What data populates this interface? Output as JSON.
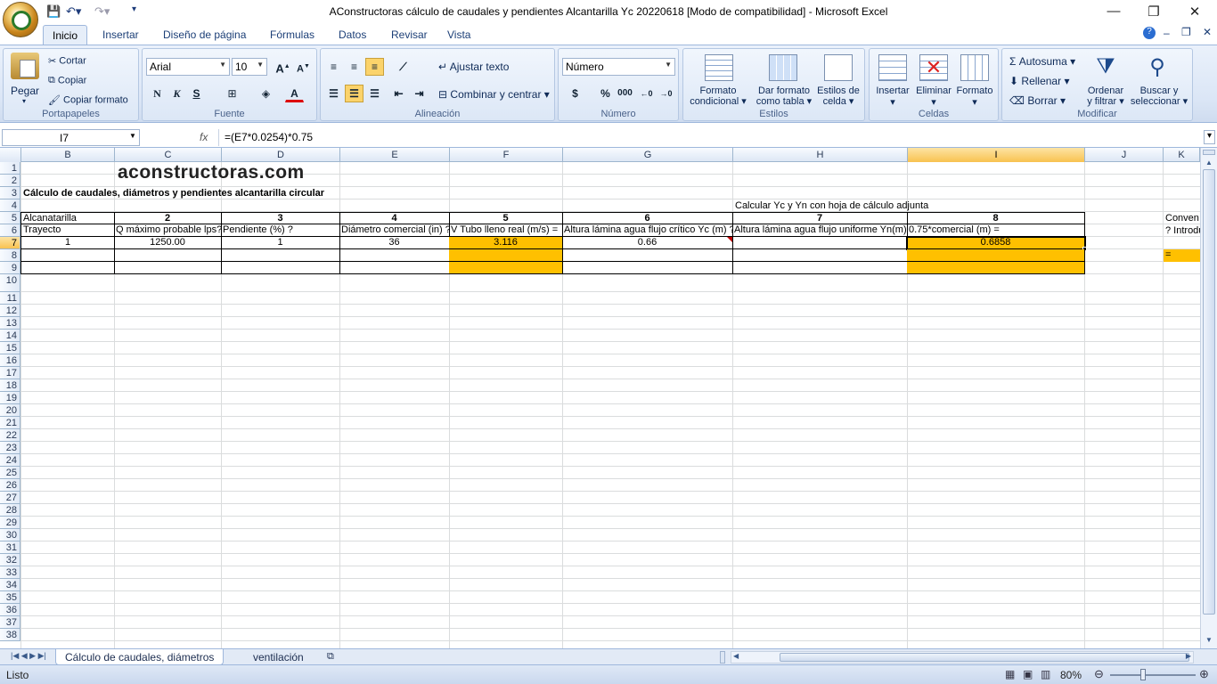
{
  "window": {
    "title": "AConstructoras cálculo de caudales y pendientes Alcantarilla Yc 20220618  [Modo de compatibilidad] - Microsoft Excel",
    "min": "—",
    "restore": "❐",
    "close": "✕"
  },
  "tabs": [
    "Inicio",
    "Insertar",
    "Diseño de página",
    "Fórmulas",
    "Datos",
    "Revisar",
    "Vista"
  ],
  "ribbon": {
    "portapapeles": {
      "label": "Portapapeles",
      "pegar": "Pegar",
      "cortar": "Cortar",
      "copiar": "Copiar",
      "copiar_formato": "Copiar formato"
    },
    "fuente": {
      "label": "Fuente",
      "font": "Arial",
      "size": "10",
      "bold": "N",
      "italic": "K",
      "underline": "S"
    },
    "alineacion": {
      "label": "Alineación",
      "ajustar": "Ajustar texto",
      "combinar": "Combinar y centrar"
    },
    "numero": {
      "label": "Número",
      "format": "Número",
      "currency": "$",
      "percent": "%",
      "thousands": "000"
    },
    "estilos": {
      "label": "Estilos",
      "formato_cond": [
        "Formato",
        "condicional"
      ],
      "dar_formato": [
        "Dar formato",
        "como tabla"
      ],
      "estilos_celda": [
        "Estilos de",
        "celda"
      ]
    },
    "celdas": {
      "label": "Celdas",
      "insertar": "Insertar",
      "eliminar": "Eliminar",
      "formato": "Formato"
    },
    "modificar": {
      "label": "Modificar",
      "autosuma": "Autosuma",
      "rellenar": "Rellenar",
      "borrar": "Borrar",
      "ordenar": [
        "Ordenar",
        "y filtrar"
      ],
      "buscar": [
        "Buscar y",
        "seleccionar"
      ]
    }
  },
  "formula_bar": {
    "name_box": "I7",
    "fx": "fx",
    "formula": "=(E7*0.0254)*0.75"
  },
  "columns": [
    "B",
    "C",
    "D",
    "E",
    "F",
    "G",
    "H",
    "I",
    "J",
    "K"
  ],
  "rows": [
    "1",
    "2",
    "3",
    "4",
    "5",
    "6",
    "7",
    "8",
    "9",
    "10",
    "11",
    "12",
    "13",
    "14",
    "15",
    "16",
    "17",
    "18",
    "19",
    "20",
    "21",
    "22",
    "23",
    "24",
    "25",
    "26",
    "27",
    "28",
    "29",
    "30",
    "31",
    "32",
    "33",
    "34",
    "35",
    "36",
    "37",
    "38"
  ],
  "sheet": {
    "logo": "aconstructoras.com",
    "title": "Cálculo de caudales, diámetros y pendientes alcantarilla circular",
    "note": "Calcular Yc y Yn con hoja de cálculo adjunta",
    "r5": {
      "b": "Alcanatarilla",
      "c": "2",
      "d": "3",
      "e": "4",
      "f": "5",
      "g": "6",
      "h": "7",
      "i": "8",
      "k": "Conven"
    },
    "r6": {
      "b": "Trayecto",
      "c": "Q máximo probable lps?",
      "d": "Pendiente (%) ?",
      "e": "Diámetro comercial (in) ?",
      "f": "V Tubo lleno real (m/s) =",
      "g": "Altura lámina agua flujo crítico Yc (m) ?",
      "h": "Altura lámina agua flujo uniforme Yn(m)",
      "i": "0.75*comercial (m) =",
      "k": "? Introdu"
    },
    "r7": {
      "b": "1",
      "c": "1250.00",
      "d": "1",
      "e": "36",
      "f": "3.116",
      "g": "0.66",
      "i": "0.6858"
    },
    "r8": {
      "k": "="
    }
  },
  "sheet_tabs": [
    "Cálculo de caudales, diámetros",
    "ventilación"
  ],
  "status": {
    "text": "Listo",
    "zoom": "80%"
  }
}
